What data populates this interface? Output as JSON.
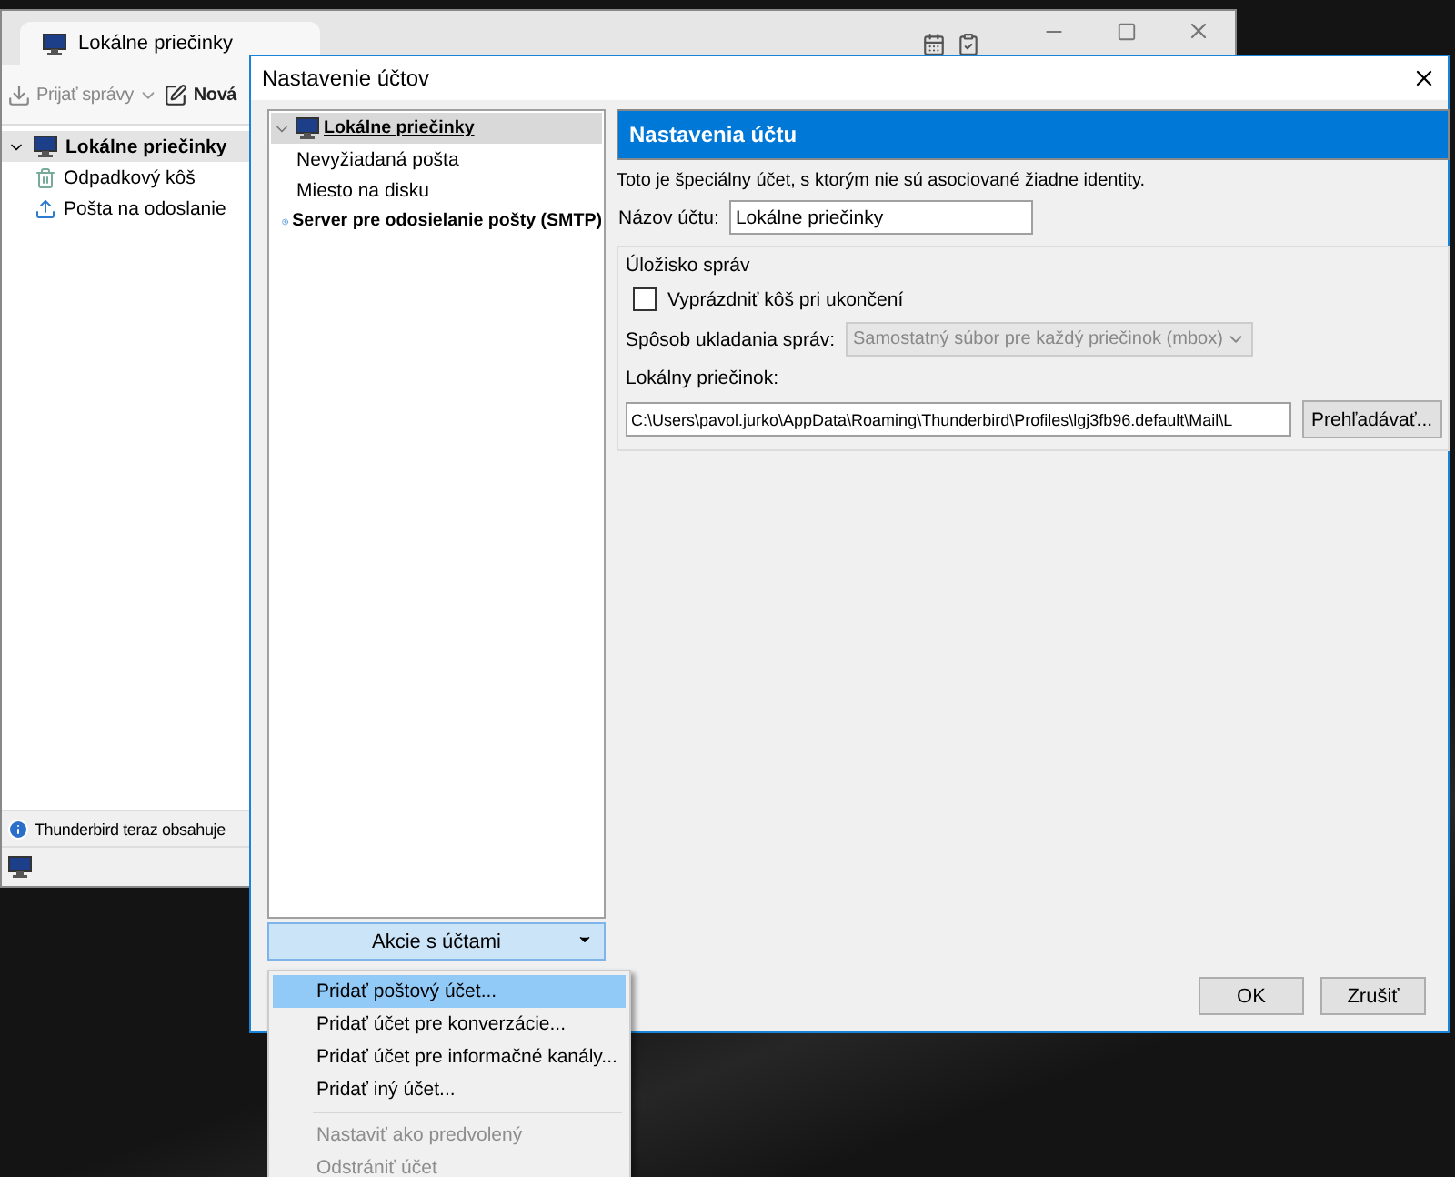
{
  "main_window": {
    "tab": {
      "label": "Lokálne priečinky"
    },
    "toolbar": [
      {
        "label": "Prijať správy",
        "kind": "get"
      },
      {
        "label": "Nová",
        "kind": "write"
      }
    ],
    "folders": [
      {
        "label": "Lokálne priečinky",
        "kind": "computer",
        "expanded": true,
        "children": [
          {
            "label": "Odpadkový kôš",
            "kind": "trash"
          },
          {
            "label": "Pošta na odoslanie",
            "kind": "outbox"
          }
        ]
      }
    ],
    "notification": {
      "text": "Thunderbird teraz obsahuje"
    }
  },
  "dialog": {
    "title": "Nastavenie účtov",
    "tree": [
      {
        "label": "Lokálne priečinky",
        "kind": "computer",
        "selected": true,
        "expanded": true,
        "children": [
          {
            "label": "Nevyžiadaná pošta",
            "selected": false
          },
          {
            "label": "Miesto na disku",
            "selected": false
          }
        ]
      },
      {
        "label": "Server pre odosielanie pošty (SMTP)",
        "kind": "server",
        "selected": false
      }
    ],
    "actions_button": {
      "label": "Akcie s účtami",
      "open": true
    },
    "menu": [
      {
        "items": [
          {
            "label": "Pridať poštový účet...",
            "selected": true,
            "disabled": false
          },
          {
            "label": "Pridať účet pre konverzácie...",
            "selected": false,
            "disabled": false
          },
          {
            "label": "Pridať účet pre informačné kanály...",
            "selected": false,
            "disabled": false
          },
          {
            "label": "Pridať iný účet...",
            "selected": false,
            "disabled": false
          }
        ]
      },
      {
        "items": [
          {
            "label": "Nastaviť ako predvolený",
            "selected": false,
            "disabled": true
          },
          {
            "label": "Odstrániť účet",
            "selected": false,
            "disabled": true
          }
        ]
      }
    ],
    "settings": {
      "header": "Nastavenia účtu",
      "note": "Toto je špeciálny účet, s ktorým nie sú asociované žiadne identity.",
      "name_label": "Názov účtu:",
      "name_value": "Lokálne priečinky",
      "storage": {
        "legend": "Úložisko správ",
        "checkbox": {
          "label": "Vyprázdniť kôš pri ukončení",
          "checked": false
        },
        "store_type": {
          "label": "Spôsob ukladania správ:",
          "value": "Samostatný súbor pre každý priečinok (mbox)",
          "disabled": true
        },
        "folder_label": "Lokálny priečinok:",
        "folder_path": "C:\\Users\\pavol.jurko\\AppData\\Roaming\\Thunderbird\\Profiles\\lgj3fb96.default\\Mail\\L",
        "browse_button": "Prehľadávať..."
      }
    },
    "buttons": [
      "OK",
      "Zrušiť"
    ]
  }
}
